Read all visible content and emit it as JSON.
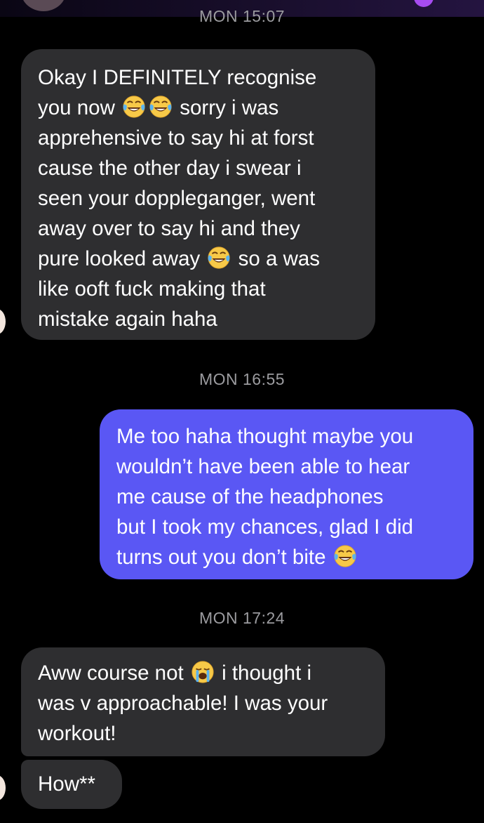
{
  "chat": {
    "timestamps": [
      "MON 15:07",
      "MON 16:55",
      "MON 17:24"
    ],
    "messages": [
      {
        "sender": "them",
        "segments": [
          "Okay I DEFINITELY recognise\nyou now ",
          " sorry i was\napprehensive to say hi at forst\ncause the other day i swear i\nseen your doppleganger, went\naway over to say hi and they\npure looked away ",
          " so a was\nlike ooft fuck making that\nmistake again haha"
        ],
        "emojis": [
          "joy-emoji",
          "joy-emoji",
          "joy-emoji"
        ]
      },
      {
        "sender": "me",
        "segments": [
          "Me too haha thought maybe you\nwouldn’t have been able to hear\nme cause of the headphones\nbut I took my chances, glad I did\nturns out you don’t bite "
        ],
        "emojis": [
          "joy-emoji"
        ]
      },
      {
        "sender": "them",
        "segments": [
          "Aww course not ",
          " i thought i\nwas v approachable! I was your\nworkout!"
        ],
        "emojis": [
          "loudly-crying-emoji"
        ]
      },
      {
        "sender": "them",
        "segments": [
          "How**"
        ],
        "emojis": []
      }
    ]
  },
  "colors": {
    "background": "#000000",
    "incoming_bubble": "#2e2e30",
    "outgoing_bubble": "#5a57f4",
    "timestamp": "#9b9b9f"
  }
}
